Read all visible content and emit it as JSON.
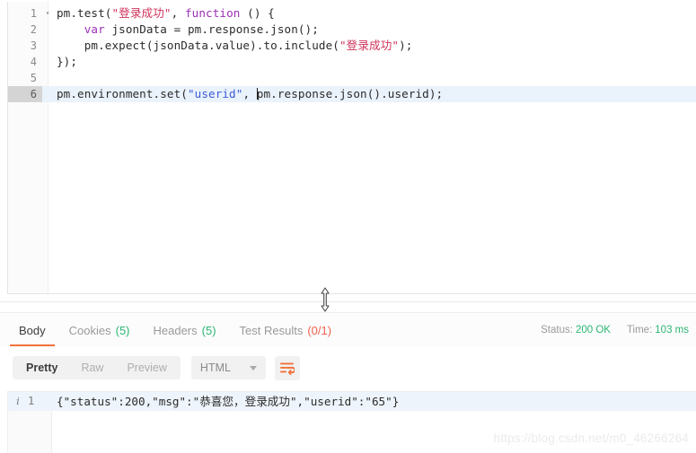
{
  "editor": {
    "name": "tests-script-editor",
    "lines": [
      {
        "number": "1",
        "fold": "▾",
        "active": false,
        "tokens": [
          {
            "t": "pm.test(",
            "c": "plain"
          },
          {
            "t": "\"登录成功\"",
            "c": "str"
          },
          {
            "t": ", ",
            "c": "plain"
          },
          {
            "t": "function",
            "c": "kw"
          },
          {
            "t": " () {",
            "c": "plain"
          }
        ]
      },
      {
        "number": "2",
        "fold": "",
        "active": false,
        "tokens": [
          {
            "t": "    ",
            "c": "plain"
          },
          {
            "t": "var",
            "c": "kw"
          },
          {
            "t": " jsonData = pm.response.json();",
            "c": "plain"
          }
        ]
      },
      {
        "number": "3",
        "fold": "",
        "active": false,
        "tokens": [
          {
            "t": "    pm.expect(jsonData.value).to.include(",
            "c": "plain"
          },
          {
            "t": "\"登录成功\"",
            "c": "str"
          },
          {
            "t": ");",
            "c": "plain"
          }
        ]
      },
      {
        "number": "4",
        "fold": "",
        "active": false,
        "tokens": [
          {
            "t": "});",
            "c": "plain"
          }
        ]
      },
      {
        "number": "5",
        "fold": "",
        "active": false,
        "tokens": [
          {
            "t": "",
            "c": "plain"
          }
        ]
      },
      {
        "number": "6",
        "fold": "",
        "active": true,
        "tokens": [
          {
            "t": "pm.environment.set(",
            "c": "plain"
          },
          {
            "t": "\"userid\"",
            "c": "str-blue"
          },
          {
            "t": ", ",
            "c": "plain"
          },
          {
            "t": "",
            "c": "caret"
          },
          {
            "t": "pm.response.json().userid);",
            "c": "plain"
          }
        ]
      }
    ]
  },
  "response": {
    "tabs": [
      {
        "label": "Body",
        "count": "",
        "active": true,
        "fail": false
      },
      {
        "label": "Cookies",
        "count": "(5)",
        "active": false,
        "fail": false
      },
      {
        "label": "Headers",
        "count": "(5)",
        "active": false,
        "fail": false
      },
      {
        "label": "Test Results",
        "count": "(0/1)",
        "active": false,
        "fail": true
      }
    ],
    "status_label": "Status:",
    "status_value": "200 OK",
    "time_label": "Time:",
    "time_value": "103 ms",
    "toolbar": {
      "view_modes": [
        {
          "label": "Pretty",
          "active": true
        },
        {
          "label": "Raw",
          "active": false
        },
        {
          "label": "Preview",
          "active": false
        }
      ],
      "format_selected": "HTML",
      "wrap_button_title": "Wrap Lines"
    },
    "body_lines": [
      {
        "info": "i",
        "number": "1",
        "text": "{\"status\":200,\"msg\":\"恭喜您，登录成功\",\"userid\":\"65\"}"
      }
    ]
  },
  "watermark": "https://blog.csdn.net/m0_46266264",
  "colors": {
    "accent_orange": "#f2713b",
    "success_green": "#2bb673",
    "fail_red": "#f0604d",
    "string_red": "#d1335b",
    "string_blue": "#3b5bdb",
    "keyword_purple": "#9b30b5",
    "active_line": "#eaf2fb"
  }
}
